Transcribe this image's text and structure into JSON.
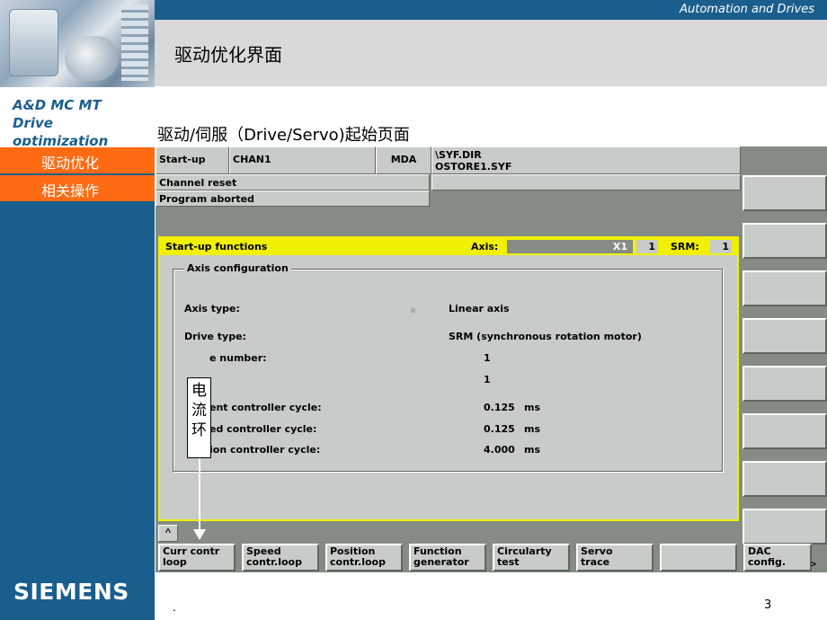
{
  "header": {
    "brand_tagline": "Automation and Drives",
    "slide_title": "驱动优化界面",
    "subtitle": "驱动/伺服（Drive/Servo)起始页面"
  },
  "sidebar": {
    "title_lines": [
      "A&D MC MT",
      "Drive",
      "optimization"
    ],
    "items": [
      {
        "label": "驱动优化"
      },
      {
        "label": "相关操作"
      }
    ],
    "logo": "SIEMENS"
  },
  "cnc": {
    "status": {
      "area": "Start-up",
      "channel": "CHAN1",
      "mode": "MDA",
      "path_line1": "\\SYF.DIR",
      "path_line2": "OSTORE1.SYF",
      "channel_state": "Channel reset",
      "program_state": "Program aborted"
    },
    "dialog": {
      "title": "Start-up functions",
      "axis_label": "Axis:",
      "axis_value": "X1",
      "axis_num": "1",
      "srm_label": "SRM:",
      "srm_num": "1",
      "group_title": "Axis configuration",
      "rows": [
        {
          "label": "Axis type:",
          "value": "Linear axis",
          "unit": ""
        },
        {
          "label": "Drive type:",
          "value": "SRM (synchronous rotation motor)",
          "unit": ""
        },
        {
          "label": "e number:",
          "value": "1",
          "unit": ""
        },
        {
          "label": "",
          "value": "1",
          "unit": ""
        },
        {
          "label": "ent controller cycle:",
          "value": "0.125",
          "unit": "ms"
        },
        {
          "label": "ed controller cycle:",
          "value": "0.125",
          "unit": "ms"
        },
        {
          "label": "ion controller cycle:",
          "value": "4.000",
          "unit": "ms"
        }
      ]
    },
    "scroll_symbol": "^",
    "softkeys": [
      {
        "line1": "Curr contr",
        "line2": "loop"
      },
      {
        "line1": "Speed",
        "line2": "contr.loop"
      },
      {
        "line1": "Position",
        "line2": "contr.loop"
      },
      {
        "line1": "Function",
        "line2": "generator"
      },
      {
        "line1": "Circularty",
        "line2": "test"
      },
      {
        "line1": "Servo",
        "line2": "trace"
      },
      {
        "line1": "",
        "line2": ""
      },
      {
        "line1": "DAC",
        "line2": "config."
      }
    ],
    "more_symbol": ">"
  },
  "annotation": {
    "chars": [
      "电",
      "流",
      "环"
    ]
  },
  "footer": {
    "dot": ".",
    "page_number": "3"
  },
  "colors": {
    "brand_blue": "#1a5e8e",
    "accent_orange": "#ff6a13",
    "dialog_yellow": "#f0f000",
    "panel_gray": "#c8ccc8"
  }
}
